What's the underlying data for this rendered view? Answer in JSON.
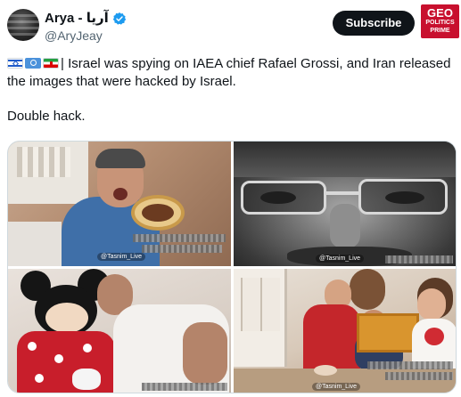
{
  "author": {
    "display_name": "Arya - آریا",
    "handle": "@AryJeay",
    "verified_icon": "verified-badge-icon",
    "verified_color": "#1d9bf0"
  },
  "header": {
    "subscribe_label": "Subscribe",
    "logo": {
      "line1": "GEO",
      "line2": "POLITICS",
      "line3": "PRIME",
      "color": "#c8102e"
    }
  },
  "tweet": {
    "flags": [
      "israel-flag-icon",
      "un-flag-icon",
      "iran-flag-icon"
    ],
    "text_1": "| Israel was spying on IAEA chief Rafael Grossi, and Iran released the images that were hacked by Israel.",
    "text_2": "Double hack."
  },
  "media": {
    "watermark": "@Tasnim_Live",
    "images": [
      {
        "name": "grossi-with-cake-photo"
      },
      {
        "name": "grossi-closeup-glasses-photo"
      },
      {
        "name": "grossi-with-mickey-mouse-photo"
      },
      {
        "name": "grossi-with-children-photo"
      }
    ]
  }
}
